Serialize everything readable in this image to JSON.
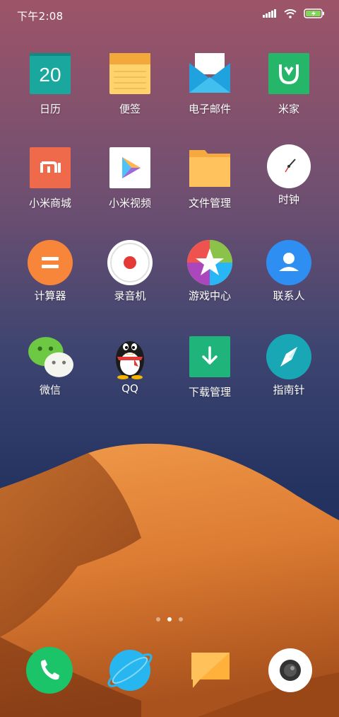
{
  "status_bar": {
    "time": "下午2:08",
    "battery_color": "#7ed957"
  },
  "apps": [
    {
      "label": "日历",
      "icon": "calendar-icon",
      "date": "20"
    },
    {
      "label": "便签",
      "icon": "notes-icon"
    },
    {
      "label": "电子邮件",
      "icon": "email-icon"
    },
    {
      "label": "米家",
      "icon": "mijia-icon"
    },
    {
      "label": "小米商城",
      "icon": "mi-store-icon"
    },
    {
      "label": "小米视频",
      "icon": "mi-video-icon"
    },
    {
      "label": "文件管理",
      "icon": "folder-icon"
    },
    {
      "label": "时钟",
      "icon": "clock-icon"
    },
    {
      "label": "计算器",
      "icon": "calculator-icon"
    },
    {
      "label": "录音机",
      "icon": "recorder-icon"
    },
    {
      "label": "游戏中心",
      "icon": "game-center-icon"
    },
    {
      "label": "联系人",
      "icon": "contacts-icon"
    },
    {
      "label": "微信",
      "icon": "wechat-icon"
    },
    {
      "label": "QQ",
      "icon": "qq-icon"
    },
    {
      "label": "下载管理",
      "icon": "download-icon"
    },
    {
      "label": "指南针",
      "icon": "compass-icon"
    }
  ],
  "page_indicator": {
    "pages": 3,
    "active": 2
  },
  "dock": [
    {
      "icon": "phone-icon"
    },
    {
      "icon": "browser-icon"
    },
    {
      "icon": "messages-icon"
    },
    {
      "icon": "camera-icon"
    }
  ]
}
